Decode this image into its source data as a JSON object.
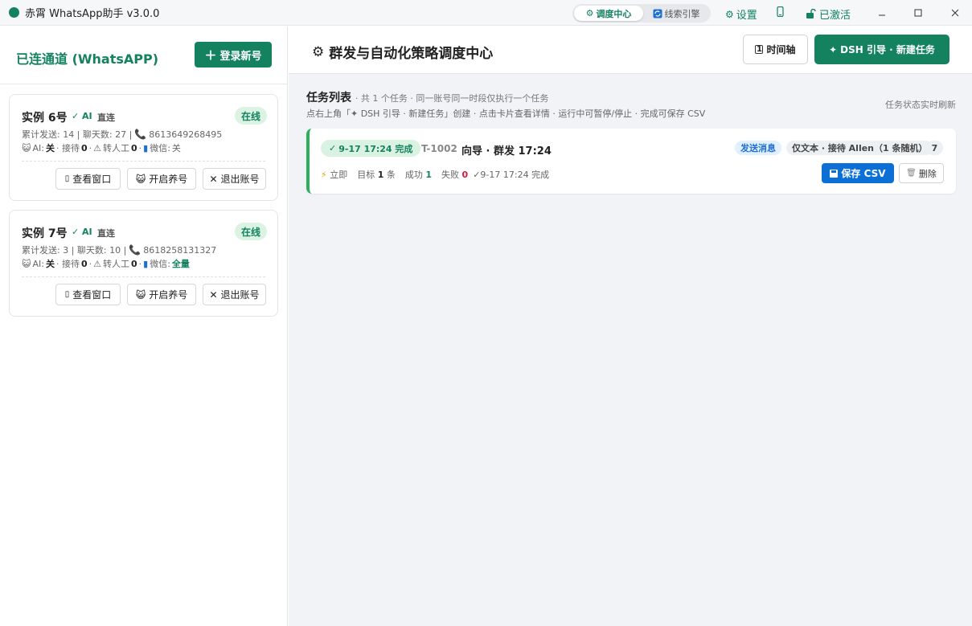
{
  "window": {
    "title": "赤霄 WhatsApp助手 v3.0.0",
    "tabs": [
      {
        "label": "调度中心",
        "icon": "gear-icon",
        "active": true
      },
      {
        "label": "线索引擎",
        "icon": "refresh-icon",
        "active": false
      }
    ],
    "settings_label": "设置",
    "activated_label": "已激活"
  },
  "sidebar": {
    "title": "已连通道 (WhatsAPP)",
    "login_button": "登录新号",
    "instances": [
      {
        "name": "实例 6号",
        "ai_badge": "AI",
        "conn_badge": "直连",
        "status": "在线",
        "sent": "累计发送: 14 | 聊天数: 27 |",
        "phone": "8613649268495",
        "ai_label": "AI:",
        "ai_state": "关",
        "reception_label": "· 接待",
        "reception_count": "0",
        "manual_label": "转人工",
        "manual_count": "0",
        "wechat_label": "微信:",
        "wechat_state": "关",
        "btn_view": "查看窗口",
        "btn_nurture": "开启养号",
        "btn_logout": "退出账号"
      },
      {
        "name": "实例 7号",
        "ai_badge": "AI",
        "conn_badge": "直连",
        "status": "在线",
        "sent": "累计发送: 3 | 聊天数: 10 |",
        "phone": "8618258131327",
        "ai_label": "AI:",
        "ai_state": "关",
        "reception_label": "· 接待",
        "reception_count": "0",
        "manual_label": "转人工",
        "manual_count": "0",
        "wechat_label": "微信:",
        "wechat_state": "全量",
        "btn_view": "查看窗口",
        "btn_nurture": "开启养号",
        "btn_logout": "退出账号"
      }
    ]
  },
  "main": {
    "title": "群发与自动化策略调度中心",
    "timeline_button": "时间轴",
    "new_task_button": "DSH 引导 · 新建任务",
    "list_title": "任务列表",
    "list_subtitle": "· 共 1 个任务 · 同一账号同一时段仅执行一个任务",
    "list_hint": "点右上角「✦ DSH 引导 · 新建任务」创建 · 点击卡片查看详情 · 运行中可暂停/停止 · 完成可保存 CSV",
    "list_refresh_note": "任务状态实时刷新",
    "tasks": [
      {
        "status": "9-17 17:24 完成",
        "id": "T-1002",
        "name": "向导 · 群发 17:24",
        "tag_type": "发送消息",
        "tag_mode": "仅文本 · 接待 Allen（1 条随机）",
        "tag_count": "7",
        "timing": "立即",
        "target_label": "目标",
        "target_value": "1",
        "target_unit": "条",
        "success_label": "成功",
        "success_value": "1",
        "fail_label": "失败",
        "fail_value": "0",
        "done_text": "9-17 17:24 完成",
        "btn_csv": "保存 CSV",
        "btn_delete": "删除"
      }
    ]
  },
  "colors": {
    "brand": "#14825f",
    "online_bg": "#dcf3e4",
    "csv_blue": "#0c6fd6",
    "fail_red": "#d01e3a"
  }
}
